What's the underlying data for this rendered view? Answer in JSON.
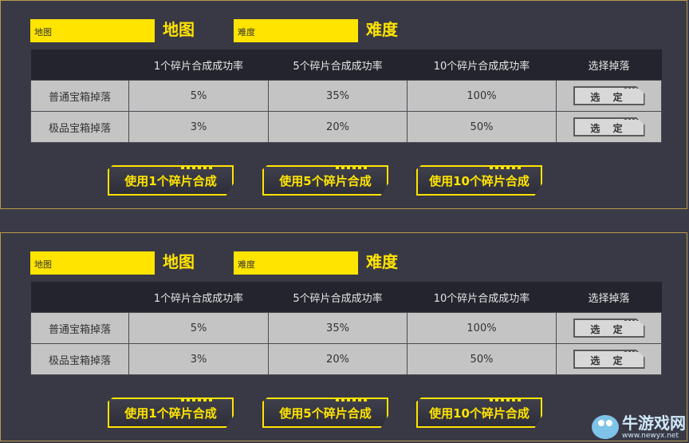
{
  "panels": [
    {
      "map_field": "地图",
      "map_label": "地图",
      "difficulty_field": "难度",
      "difficulty_label": "难度",
      "table": {
        "headers": [
          "",
          "1个碎片合成成功率",
          "5个碎片合成成功率",
          "10个碎片合成成功率",
          "选择掉落"
        ],
        "rows": [
          {
            "label": "普通宝箱掉落",
            "rate_1": "5%",
            "rate_5": "35%",
            "rate_10": "100%",
            "action": "选 定"
          },
          {
            "label": "极品宝箱掉落",
            "rate_1": "3%",
            "rate_5": "20%",
            "rate_10": "50%",
            "action": "选 定"
          }
        ]
      },
      "buttons": {
        "compose_1": "使用1个碎片合成",
        "compose_5": "使用5个碎片合成",
        "compose_10": "使用10个碎片合成"
      }
    },
    {
      "map_field": "地图",
      "map_label": "地图",
      "difficulty_field": "难度",
      "difficulty_label": "难度",
      "table": {
        "headers": [
          "",
          "1个碎片合成成功率",
          "5个碎片合成成功率",
          "10个碎片合成成功率",
          "选择掉落"
        ],
        "rows": [
          {
            "label": "普通宝箱掉落",
            "rate_1": "5%",
            "rate_5": "35%",
            "rate_10": "100%",
            "action": "选 定"
          },
          {
            "label": "极品宝箱掉落",
            "rate_1": "3%",
            "rate_5": "20%",
            "rate_10": "50%",
            "action": "选 定"
          }
        ]
      },
      "buttons": {
        "compose_1": "使用1个碎片合成",
        "compose_5": "使用5个碎片合成",
        "compose_10": "使用10个碎片合成"
      }
    }
  ],
  "watermark": {
    "name": "牛游戏网",
    "url": "www.newyx.net",
    "icon": "cow-mascot-icon"
  },
  "colors": {
    "accent": "#ffe400",
    "panel_bg": "#393946",
    "header_bg": "#24242e",
    "cell_bg": "#c4c4c4"
  }
}
